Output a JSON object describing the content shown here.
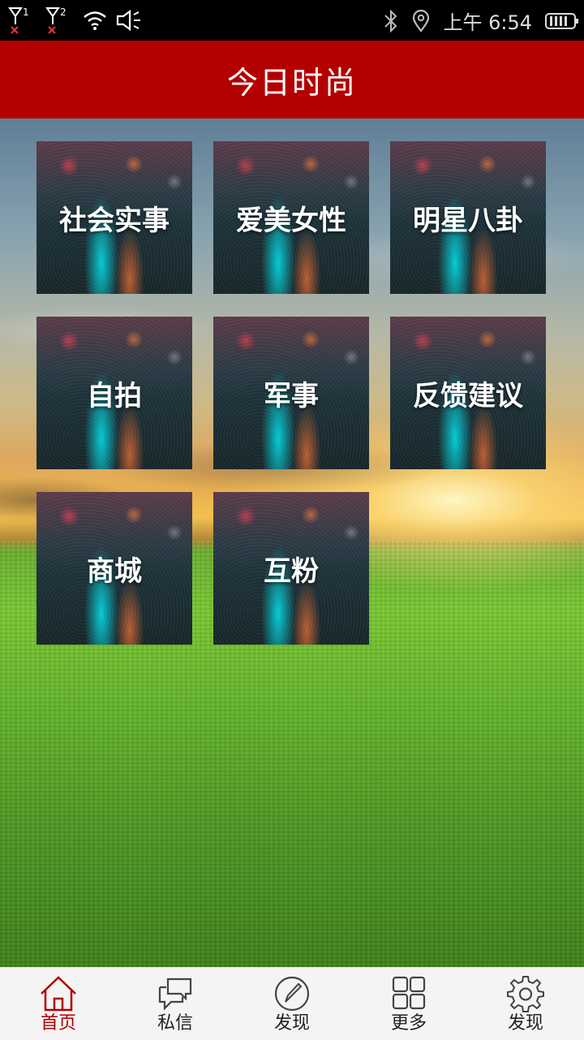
{
  "status_bar": {
    "sim1_label": "1",
    "sim2_label": "2",
    "time": "上午 6:54",
    "icons": [
      "signal-sim1-icon",
      "signal-sim2-icon",
      "wifi-icon",
      "speaker-icon",
      "bluetooth-icon",
      "location-icon",
      "battery-icon"
    ]
  },
  "header": {
    "title": "今日时尚",
    "color": "#b30000"
  },
  "grid": {
    "items": [
      {
        "label": "社会实事"
      },
      {
        "label": "爱美女性"
      },
      {
        "label": "明星八卦"
      },
      {
        "label": "自拍"
      },
      {
        "label": "军事"
      },
      {
        "label": "反馈建议"
      },
      {
        "label": "商城"
      },
      {
        "label": "互粉"
      }
    ]
  },
  "bottom_nav": {
    "items": [
      {
        "label": "首页",
        "icon": "home-icon",
        "active": true
      },
      {
        "label": "私信",
        "icon": "chat-icon",
        "active": false
      },
      {
        "label": "发现",
        "icon": "compass-icon",
        "active": false
      },
      {
        "label": "更多",
        "icon": "grid-icon",
        "active": false
      },
      {
        "label": "发现",
        "icon": "gear-icon",
        "active": false
      }
    ],
    "active_color": "#b30000"
  }
}
